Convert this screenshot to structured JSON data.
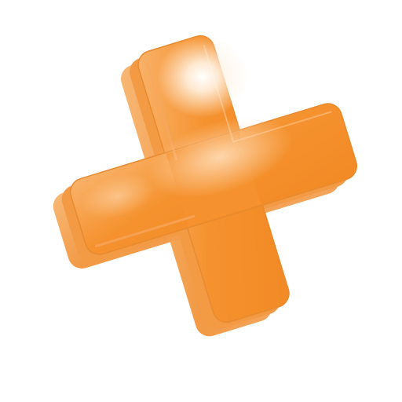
{
  "icon": {
    "name": "plus-icon",
    "colors": {
      "base": "#F5922F",
      "highlight": "#FFF6EC",
      "shadow": "#E07A18",
      "background": "#FFFFFF"
    }
  }
}
